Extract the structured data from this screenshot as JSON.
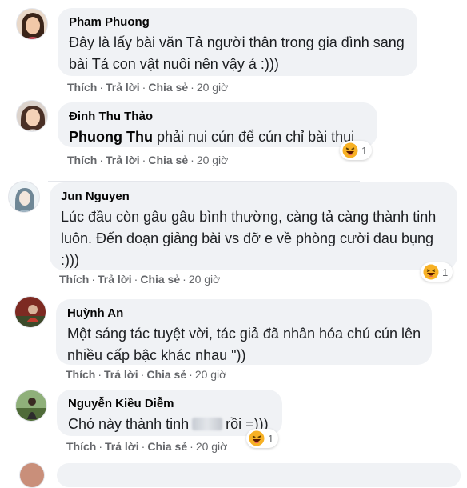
{
  "actions": {
    "like": "Thích",
    "reply": "Trả lời",
    "share": "Chia sẻ",
    "sep": "·"
  },
  "reaction_icon": "haha-emoji-icon",
  "comments": [
    {
      "author": "Pham Phuong",
      "text": "Đây là lấy bài văn Tả người thân trong gia đình sang bài Tả con vật nuôi nên vậy á :)))",
      "time": "20 giờ"
    },
    {
      "author": "Đinh Thu Thảo",
      "mention": "Phuong Thu",
      "text": " phải nui cún để cún chỉ bài thui",
      "time": "20 giờ",
      "reaction_count": "1"
    },
    {
      "author": "Jun Nguyen",
      "text": "Lúc đầu còn gâu gâu bình thường, càng tả càng thành tinh luôn. Đến đoạn giảng bài vs đỡ e về phòng cười đau bụng :)))",
      "time": "20 giờ",
      "reaction_count": "1"
    },
    {
      "author": "Huỳnh An",
      "text": "Một sáng tác tuyệt vời, tác giả đã nhân hóa chú cún lên nhiều cấp bậc khác nhau \"))",
      "time": "20 giờ"
    },
    {
      "author": "Nguyễn Kiều Diễm",
      "text_before": "Chó này thành tinh",
      "text_after": "rồi =)))",
      "time": "20 giờ",
      "reaction_count": "1"
    }
  ]
}
